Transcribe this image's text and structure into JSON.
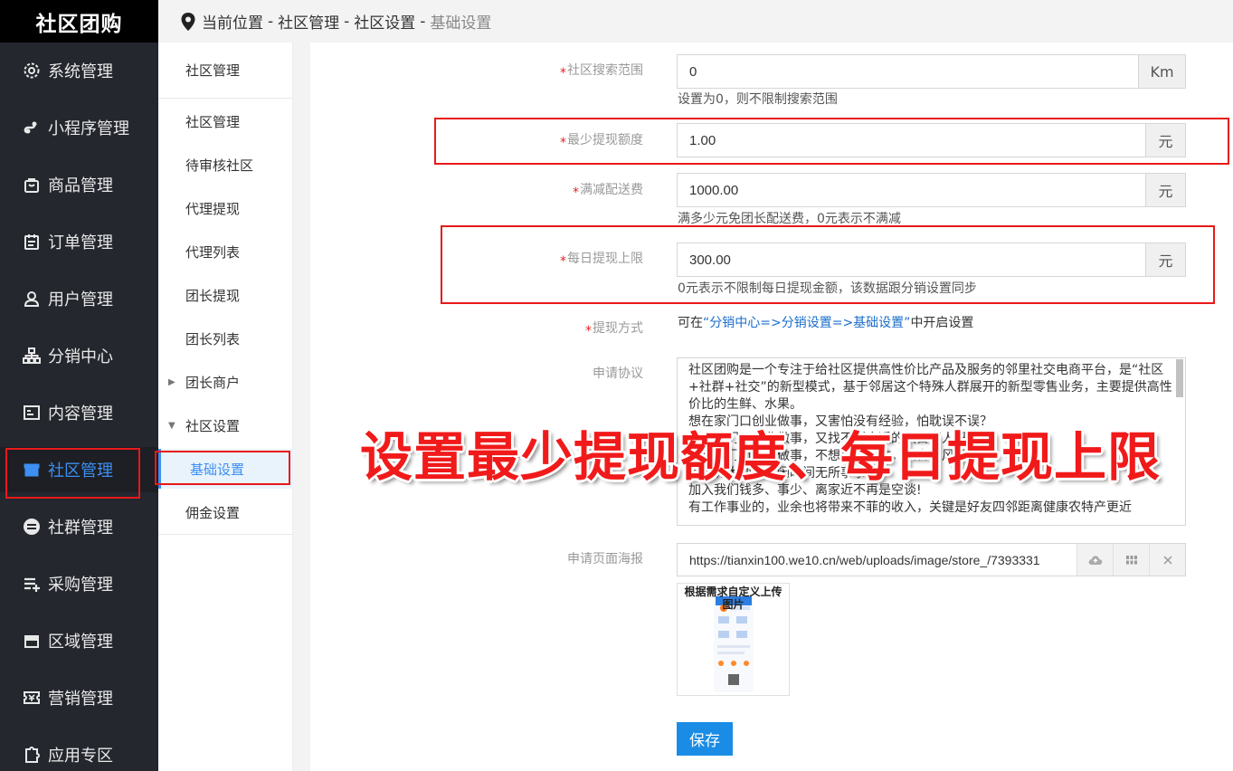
{
  "app": {
    "logo": "社区团购"
  },
  "sidebar": {
    "items": [
      {
        "label": "系统管理",
        "icon": "gear-icon"
      },
      {
        "label": "小程序管理",
        "icon": "miniprogram-icon"
      },
      {
        "label": "商品管理",
        "icon": "bag-icon"
      },
      {
        "label": "订单管理",
        "icon": "calendar-icon"
      },
      {
        "label": "用户管理",
        "icon": "user-icon"
      },
      {
        "label": "分销中心",
        "icon": "org-chart-icon"
      },
      {
        "label": "内容管理",
        "icon": "content-icon"
      },
      {
        "label": "社区管理",
        "icon": "store-icon",
        "active": true
      },
      {
        "label": "社群管理",
        "icon": "group-icon"
      },
      {
        "label": "采购管理",
        "icon": "list-add-icon"
      },
      {
        "label": "区域管理",
        "icon": "store-icon"
      },
      {
        "label": "营销管理",
        "icon": "ticket-icon"
      },
      {
        "label": "应用专区",
        "icon": "puzzle-icon"
      }
    ]
  },
  "breadcrumb": {
    "current_label": "当前位置",
    "sep": "-",
    "items": [
      "社区管理",
      "社区设置",
      "基础设置"
    ]
  },
  "subnav": {
    "header": "社区管理",
    "items": [
      {
        "label": "社区管理"
      },
      {
        "label": "待审核社区"
      },
      {
        "label": "代理提现"
      },
      {
        "label": "代理列表"
      },
      {
        "label": "团长提现"
      },
      {
        "label": "团长列表"
      },
      {
        "label": "团长商户",
        "caret": "▶"
      },
      {
        "label": "社区设置",
        "caret": "▼"
      },
      {
        "label": "基础设置",
        "active": true
      },
      {
        "label": "佣金设置"
      }
    ]
  },
  "form": {
    "search_range": {
      "label": "社区搜索范围",
      "value": "0",
      "unit": "Km",
      "help": "设置为0，则不限制搜索范围"
    },
    "min_withdraw": {
      "label": "最少提现额度",
      "value": "1.00",
      "unit": "元"
    },
    "free_delivery": {
      "label": "满减配送费",
      "value": "1000.00",
      "unit": "元",
      "help": "满多少元免团长配送费，0元表示不满减"
    },
    "daily_limit": {
      "label": "每日提现上限",
      "value": "300.00",
      "unit": "元",
      "help": "0元表示不限制每日提现金额，该数据跟分销设置同步"
    },
    "withdraw_method": {
      "label": "提现方式",
      "help_prefix": "可在",
      "help_link": "“分销中心=>分销设置=>基础设置”",
      "help_suffix": "中开启设置"
    },
    "agreement": {
      "label": "申请协议",
      "text": "社区团购是一个专注于给社区提供高性价比产品及服务的邻里社交电商平台，是“社区+社群+社交”的新型模式，基于邻居这个特殊人群展开的新型零售业务，主要提供高性价比的生鲜、水果。\n想在家门口创业做事，又害怕没有经验，怕耽误不误？\n想在家门口创业做事，又找不到合适的项目和人吗？\n想在家门口创业做事，不想放弃工作，又害怕风险？\n每天有大把的空闲时间无所事事？\n加入我们钱多、事少、离家近不再是空谈!\n有工作事业的，业余也将带来不菲的收入，关键是好友四邻距离健康农特产更近"
    },
    "poster": {
      "label": "申请页面海报",
      "url": "https://tianxin100.we10.cn/web/uploads/image/store_/7393331",
      "thumb_caption": "根据需求自定义上传图片"
    },
    "save_label": "保存"
  },
  "overlay": {
    "caption": "设置最少提现额度、每日提现上限"
  },
  "colors": {
    "accent": "#3d8ff2",
    "sidebar_bg": "#24272e",
    "highlight": "#e81919",
    "save": "#1a8ce6"
  }
}
